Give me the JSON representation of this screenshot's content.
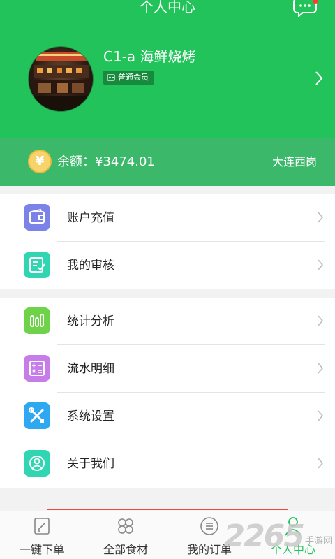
{
  "header": {
    "title": "个人中心",
    "message_icon": "chat-bubble-icon",
    "user_name": "C1-a 海鲜烧烤",
    "member_level": "普通会员",
    "avatar_icon": "avatar-photo",
    "colors": {
      "primary": "#22c35a",
      "balance_bar": "#3cb86a",
      "badge": "#178a3d"
    }
  },
  "balance": {
    "text": "余额：¥3474.01",
    "coin_symbol": "¥",
    "location": "大连西岗"
  },
  "menu": {
    "group1": [
      {
        "label": "账户充值",
        "icon": "wallet-icon",
        "color": "#7b83e8"
      },
      {
        "label": "我的审核",
        "icon": "review-icon",
        "color": "#2fd6b1"
      }
    ],
    "group2": [
      {
        "label": "统计分析",
        "icon": "chart-icon",
        "color": "#6fd34a"
      },
      {
        "label": "流水明细",
        "icon": "calculator-icon",
        "color": "#c77de9"
      },
      {
        "label": "系统设置",
        "icon": "tools-icon",
        "color": "#2ea8f0"
      },
      {
        "label": "关于我们",
        "icon": "user-circle-icon",
        "color": "#2fd6b1"
      }
    ]
  },
  "tabbar": [
    {
      "label": "一键下单",
      "icon": "quick-order-icon"
    },
    {
      "label": "全部食材",
      "icon": "clover-icon"
    },
    {
      "label": "我的订单",
      "icon": "order-list-icon"
    },
    {
      "label": "个人中心",
      "icon": "person-icon",
      "active": true
    }
  ],
  "watermark": {
    "number": "2265",
    "text": "手游网"
  }
}
